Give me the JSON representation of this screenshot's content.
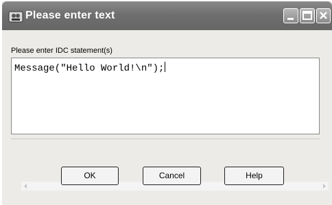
{
  "window": {
    "title": "Please enter text"
  },
  "editor": {
    "label": "Please enter IDC statement(s)",
    "value": "Message(\"Hello World!\\n\");"
  },
  "buttons": {
    "ok": "OK",
    "cancel": "Cancel",
    "help": "Help"
  },
  "icons": {
    "app": "ida-app-icon",
    "minimize": "minimize-icon",
    "maximize": "maximize-icon",
    "close": "close-icon"
  }
}
